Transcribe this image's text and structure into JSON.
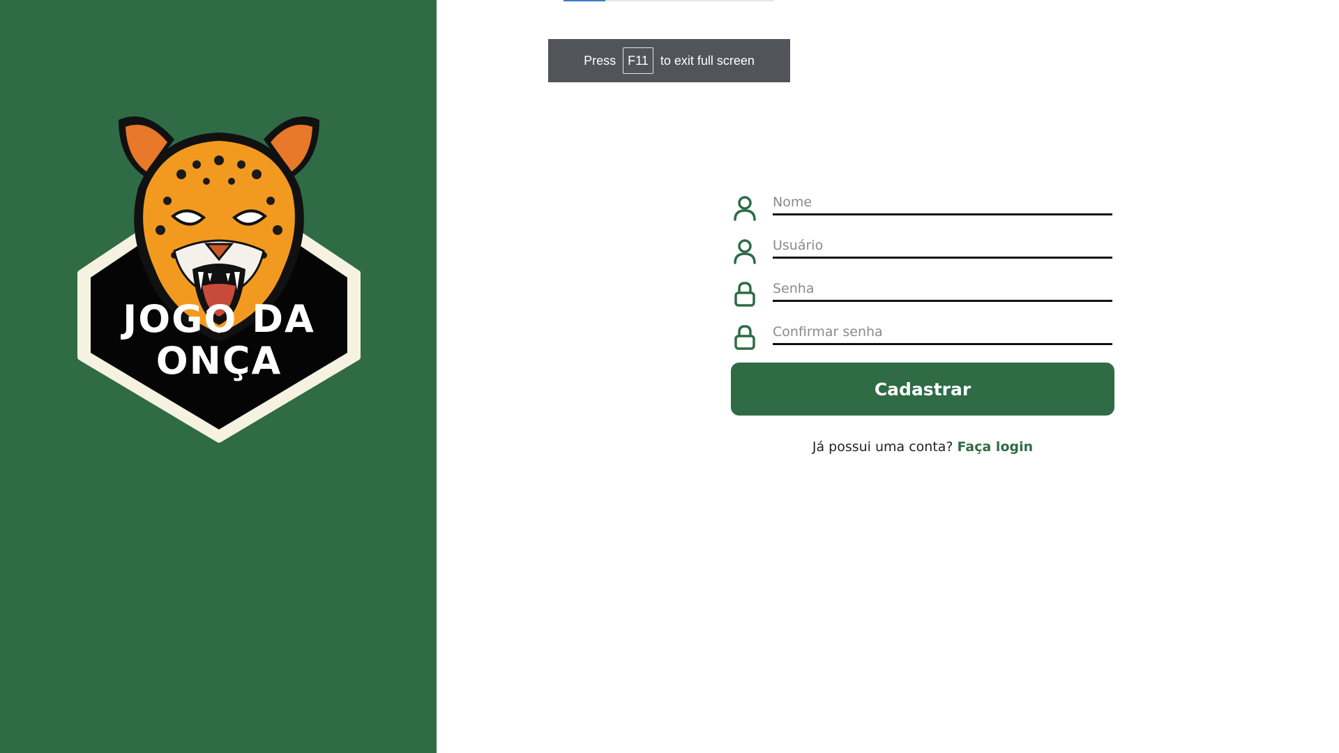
{
  "colors": {
    "brand_green": "#2f6b45",
    "toast_bg": "#515458",
    "progress_fill": "#3b7ac8"
  },
  "fullscreen_toast": {
    "prefix": "Press",
    "key": "F11",
    "suffix": "to exit full screen"
  },
  "page_load_progress": 0.2,
  "logo": {
    "text_line1": "JOGO DA",
    "text_line2": "ONÇA"
  },
  "form": {
    "fields": [
      {
        "placeholder": "Nome",
        "icon": "user-icon",
        "value": ""
      },
      {
        "placeholder": "Usuário",
        "icon": "user-icon",
        "value": ""
      },
      {
        "placeholder": "Senha",
        "icon": "lock-icon",
        "value": ""
      },
      {
        "placeholder": "Confirmar senha",
        "icon": "lock-icon",
        "value": ""
      }
    ],
    "submit_label": "Cadastrar",
    "login_prompt": "Já possui uma conta?",
    "login_link": "Faça login"
  }
}
